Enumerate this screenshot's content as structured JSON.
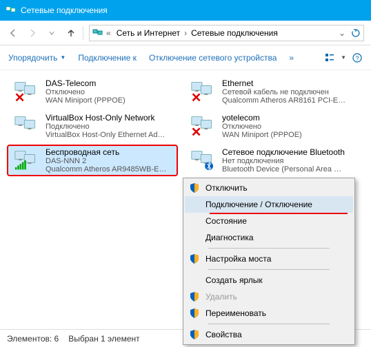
{
  "window": {
    "title": "Сетевые подключения"
  },
  "breadcrumb": {
    "parent": "Сеть и Интернет",
    "current": "Сетевые подключения"
  },
  "toolbar": {
    "organize": "Упорядочить",
    "connect": "Подключение к",
    "disable": "Отключение сетевого устройства",
    "more": "»"
  },
  "connections": [
    {
      "name": "DAS-Telecom",
      "status": "Отключено",
      "device": "WAN Miniport (PPPOE)",
      "disconnected": true
    },
    {
      "name": "Ethernet",
      "status": "Сетевой кабель не подключен",
      "device": "Qualcomm Atheros AR8161 PCI-E…",
      "disconnected": true
    },
    {
      "name": "VirtualBox Host-Only Network",
      "status": "Подключено",
      "device": "VirtualBox Host-Only Ethernet Ad…",
      "disconnected": false
    },
    {
      "name": "yotelecom",
      "status": "Отключено",
      "device": "WAN Miniport (PPPOE)",
      "disconnected": true
    },
    {
      "name": "Беспроводная сеть",
      "status": "DAS-NNN  2",
      "device": "Qualcomm Atheros AR9485WB-E…",
      "disconnected": false
    },
    {
      "name": "Сетевое подключение Bluetooth",
      "status": "Нет подключения",
      "device": "Bluetooth Device (Personal Area …",
      "disconnected": true
    }
  ],
  "context_menu": {
    "items": [
      {
        "label": "Отключить",
        "shield": true
      },
      {
        "label": "Подключение / Отключение",
        "shield": false,
        "hovered": true,
        "underlined": true
      },
      {
        "label": "Состояние",
        "shield": false
      },
      {
        "label": "Диагностика",
        "shield": false
      },
      {
        "sep": true
      },
      {
        "label": "Настройка моста",
        "shield": true
      },
      {
        "sep": true
      },
      {
        "label": "Создать ярлык",
        "shield": false
      },
      {
        "label": "Удалить",
        "shield": true,
        "disabled": true
      },
      {
        "label": "Переименовать",
        "shield": true
      },
      {
        "sep": true
      },
      {
        "label": "Свойства",
        "shield": true
      }
    ]
  },
  "statusbar": {
    "elements": "Элементов: 6",
    "selected": "Выбран 1 элемент"
  }
}
